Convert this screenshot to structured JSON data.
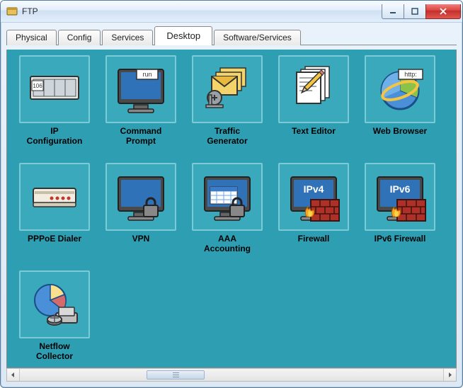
{
  "window": {
    "title": "FTP"
  },
  "tabs": [
    {
      "label": "Physical",
      "active": false
    },
    {
      "label": "Config",
      "active": false
    },
    {
      "label": "Services",
      "active": false
    },
    {
      "label": "Desktop",
      "active": true
    },
    {
      "label": "Software/Services",
      "active": false
    }
  ],
  "apps": [
    {
      "id": "ip-configuration",
      "label": "IP\nConfiguration",
      "icon": "ip-config-icon"
    },
    {
      "id": "command-prompt",
      "label": "Command\nPrompt",
      "icon": "command-prompt-icon"
    },
    {
      "id": "traffic-generator",
      "label": "Traffic\nGenerator",
      "icon": "traffic-generator-icon"
    },
    {
      "id": "text-editor",
      "label": "Text Editor",
      "icon": "text-editor-icon"
    },
    {
      "id": "web-browser",
      "label": "Web Browser",
      "icon": "web-browser-icon"
    },
    {
      "id": "pppoe-dialer",
      "label": "PPPoE Dialer",
      "icon": "pppoe-dialer-icon"
    },
    {
      "id": "vpn",
      "label": "VPN",
      "icon": "vpn-icon"
    },
    {
      "id": "aaa-accounting",
      "label": "AAA\nAccounting",
      "icon": "aaa-accounting-icon"
    },
    {
      "id": "firewall",
      "label": "Firewall",
      "icon": "firewall-ipv4-icon",
      "badge": "IPv4"
    },
    {
      "id": "ipv6-firewall",
      "label": "IPv6 Firewall",
      "icon": "firewall-ipv6-icon",
      "badge": "IPv6"
    },
    {
      "id": "netflow-collector",
      "label": "Netflow\nCollector",
      "icon": "netflow-collector-icon"
    }
  ],
  "colors": {
    "panel_bg": "#2e9fb3",
    "close_btn": "#d9403a"
  }
}
